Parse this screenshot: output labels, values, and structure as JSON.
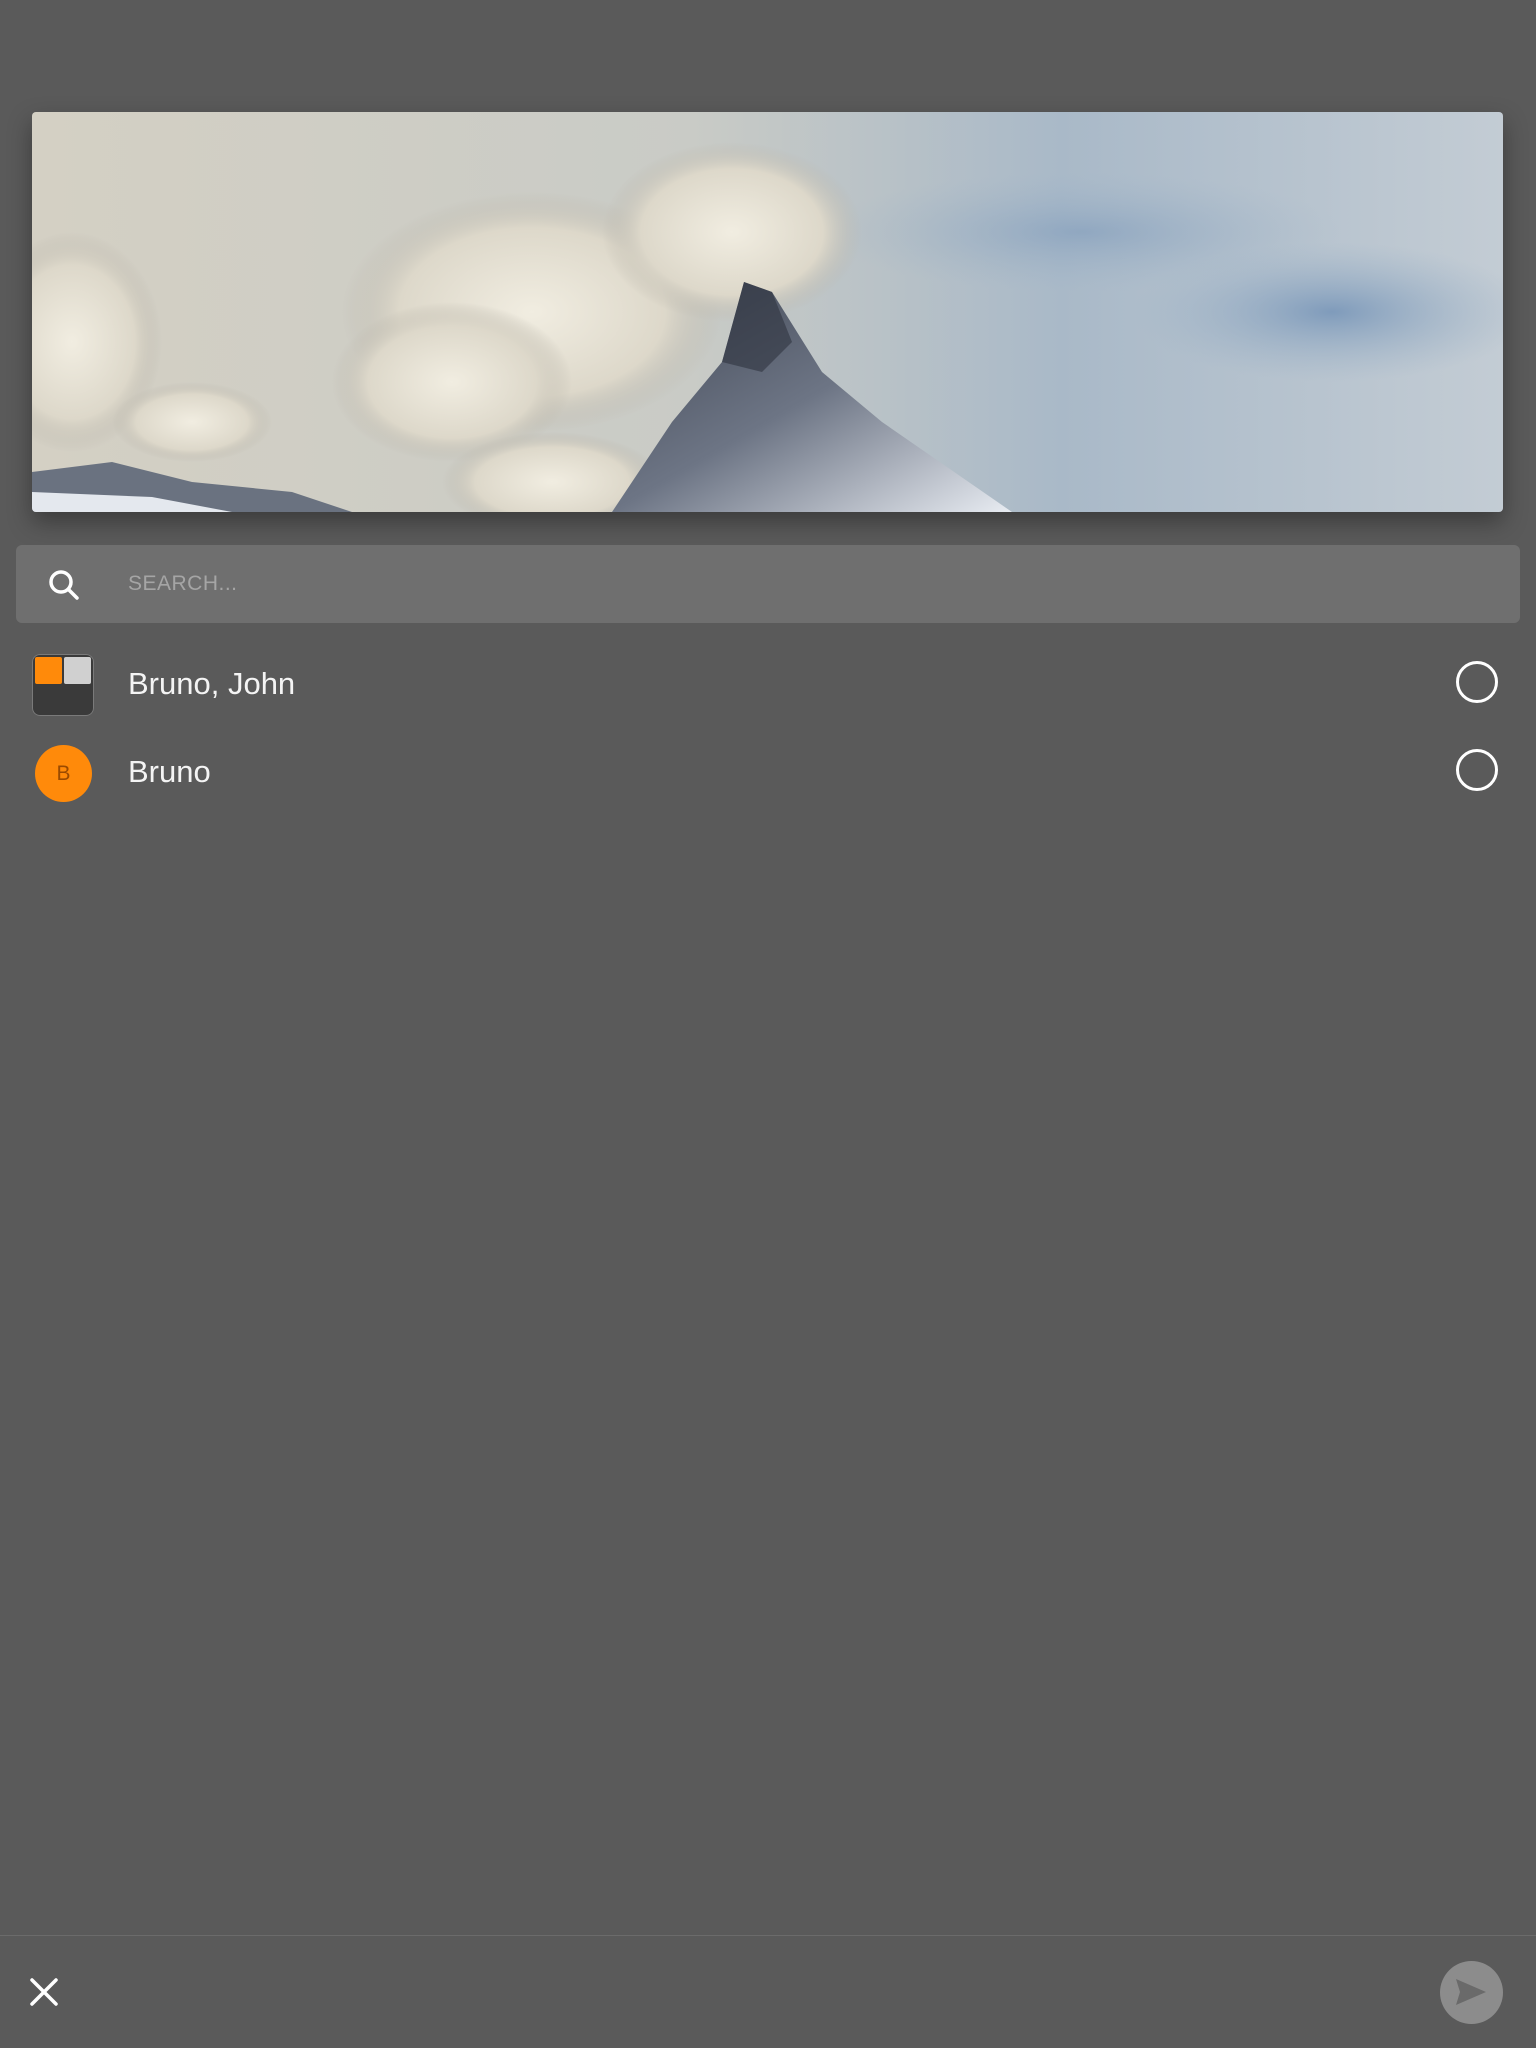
{
  "hero": {
    "image_alt": "Mountain peak with clouds"
  },
  "search": {
    "placeholder": "SEARCH...",
    "value": "",
    "icon": "search-icon"
  },
  "contacts": [
    {
      "name": "Bruno, John",
      "avatar_type": "group-grid",
      "avatar_colors": [
        "#ff8a0a",
        "#d0d0d0",
        "#3a3a3a",
        "#3a3a3a"
      ],
      "selected": false
    },
    {
      "name": "Bruno",
      "avatar_type": "initial",
      "avatar_initial": "B",
      "avatar_color": "#ff8a0a",
      "selected": false
    }
  ],
  "bottom_bar": {
    "close_icon": "close-icon",
    "send_icon": "send-icon"
  },
  "colors": {
    "background": "#5a5a5a",
    "search_bg": "#6f6f6f",
    "accent": "#ff8a0a",
    "send_button": "#8c8c8c"
  }
}
